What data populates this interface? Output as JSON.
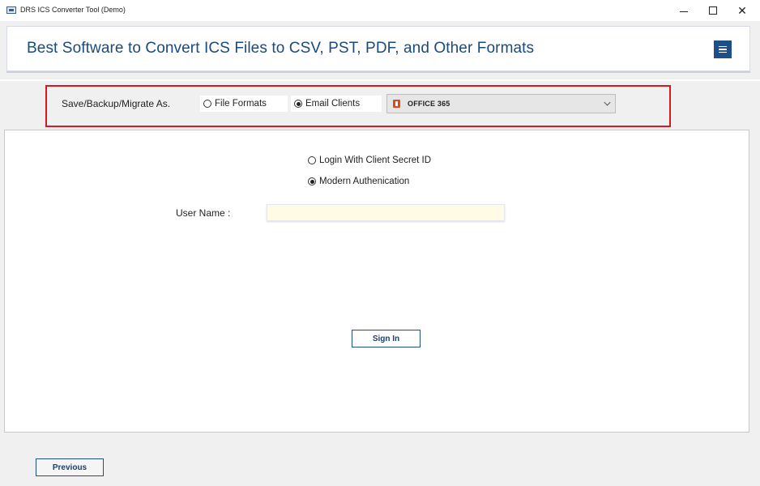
{
  "window": {
    "title": "DRS ICS Converter Tool (Demo)",
    "controls": {
      "minimize": "minimize",
      "maximize": "maximize",
      "close": "✕"
    }
  },
  "banner": {
    "title": "Best Software to Convert ICS Files to CSV, PST, PDF, and Other Formats",
    "menu_icon": "hamburger-icon",
    "color": "#1b4a7e"
  },
  "options": {
    "label": "Save/Backup/Migrate As.",
    "radios": [
      {
        "label": "File Formats",
        "checked": false
      },
      {
        "label": "Email Clients",
        "checked": true
      }
    ],
    "select": {
      "value": "OFFICE 365",
      "icon": "office365-icon"
    },
    "highlight_color": "#d71920"
  },
  "auth": {
    "options": [
      {
        "label": "Login With Client Secret ID",
        "checked": false
      },
      {
        "label": "Modern Authenication",
        "checked": true
      }
    ],
    "username_label": "User Name :",
    "username_value": "",
    "signin_label": "Sign In"
  },
  "footer": {
    "previous_label": "Previous"
  }
}
